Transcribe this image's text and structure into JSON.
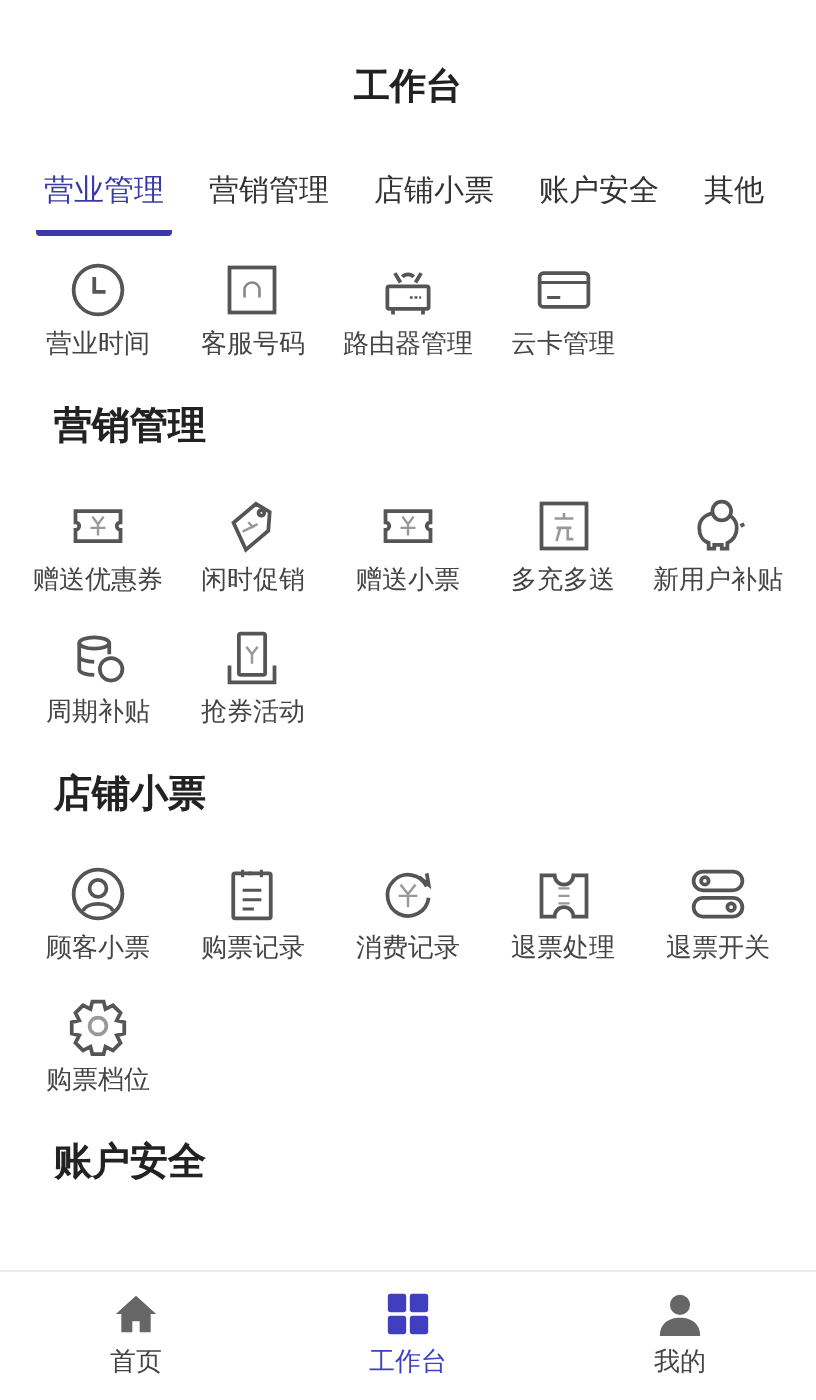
{
  "header": {
    "title": "工作台"
  },
  "tabs": [
    {
      "label": "营业管理",
      "selected": true
    },
    {
      "label": "营销管理",
      "selected": false
    },
    {
      "label": "店铺小票",
      "selected": false
    },
    {
      "label": "账户安全",
      "selected": false
    },
    {
      "label": "其他",
      "selected": false
    }
  ],
  "sections": [
    {
      "items": [
        {
          "label": "营业时间"
        },
        {
          "label": "客服号码"
        },
        {
          "label": "路由器管理"
        },
        {
          "label": "云卡管理"
        }
      ]
    },
    {
      "title": "营销管理",
      "items": [
        {
          "label": "赠送优惠券"
        },
        {
          "label": "闲时促销"
        },
        {
          "label": "赠送小票"
        },
        {
          "label": "多充多送"
        },
        {
          "label": "新用户补贴"
        },
        {
          "label": "周期补贴"
        },
        {
          "label": "抢券活动"
        }
      ]
    },
    {
      "title": "店铺小票",
      "items": [
        {
          "label": "顾客小票"
        },
        {
          "label": "购票记录"
        },
        {
          "label": "消费记录"
        },
        {
          "label": "退票处理"
        },
        {
          "label": "退票开关"
        },
        {
          "label": "购票档位"
        }
      ]
    },
    {
      "title": "账户安全"
    }
  ],
  "bottom_nav": [
    {
      "label": "首页",
      "selected": false
    },
    {
      "label": "工作台",
      "selected": true
    },
    {
      "label": "我的",
      "selected": false
    }
  ]
}
